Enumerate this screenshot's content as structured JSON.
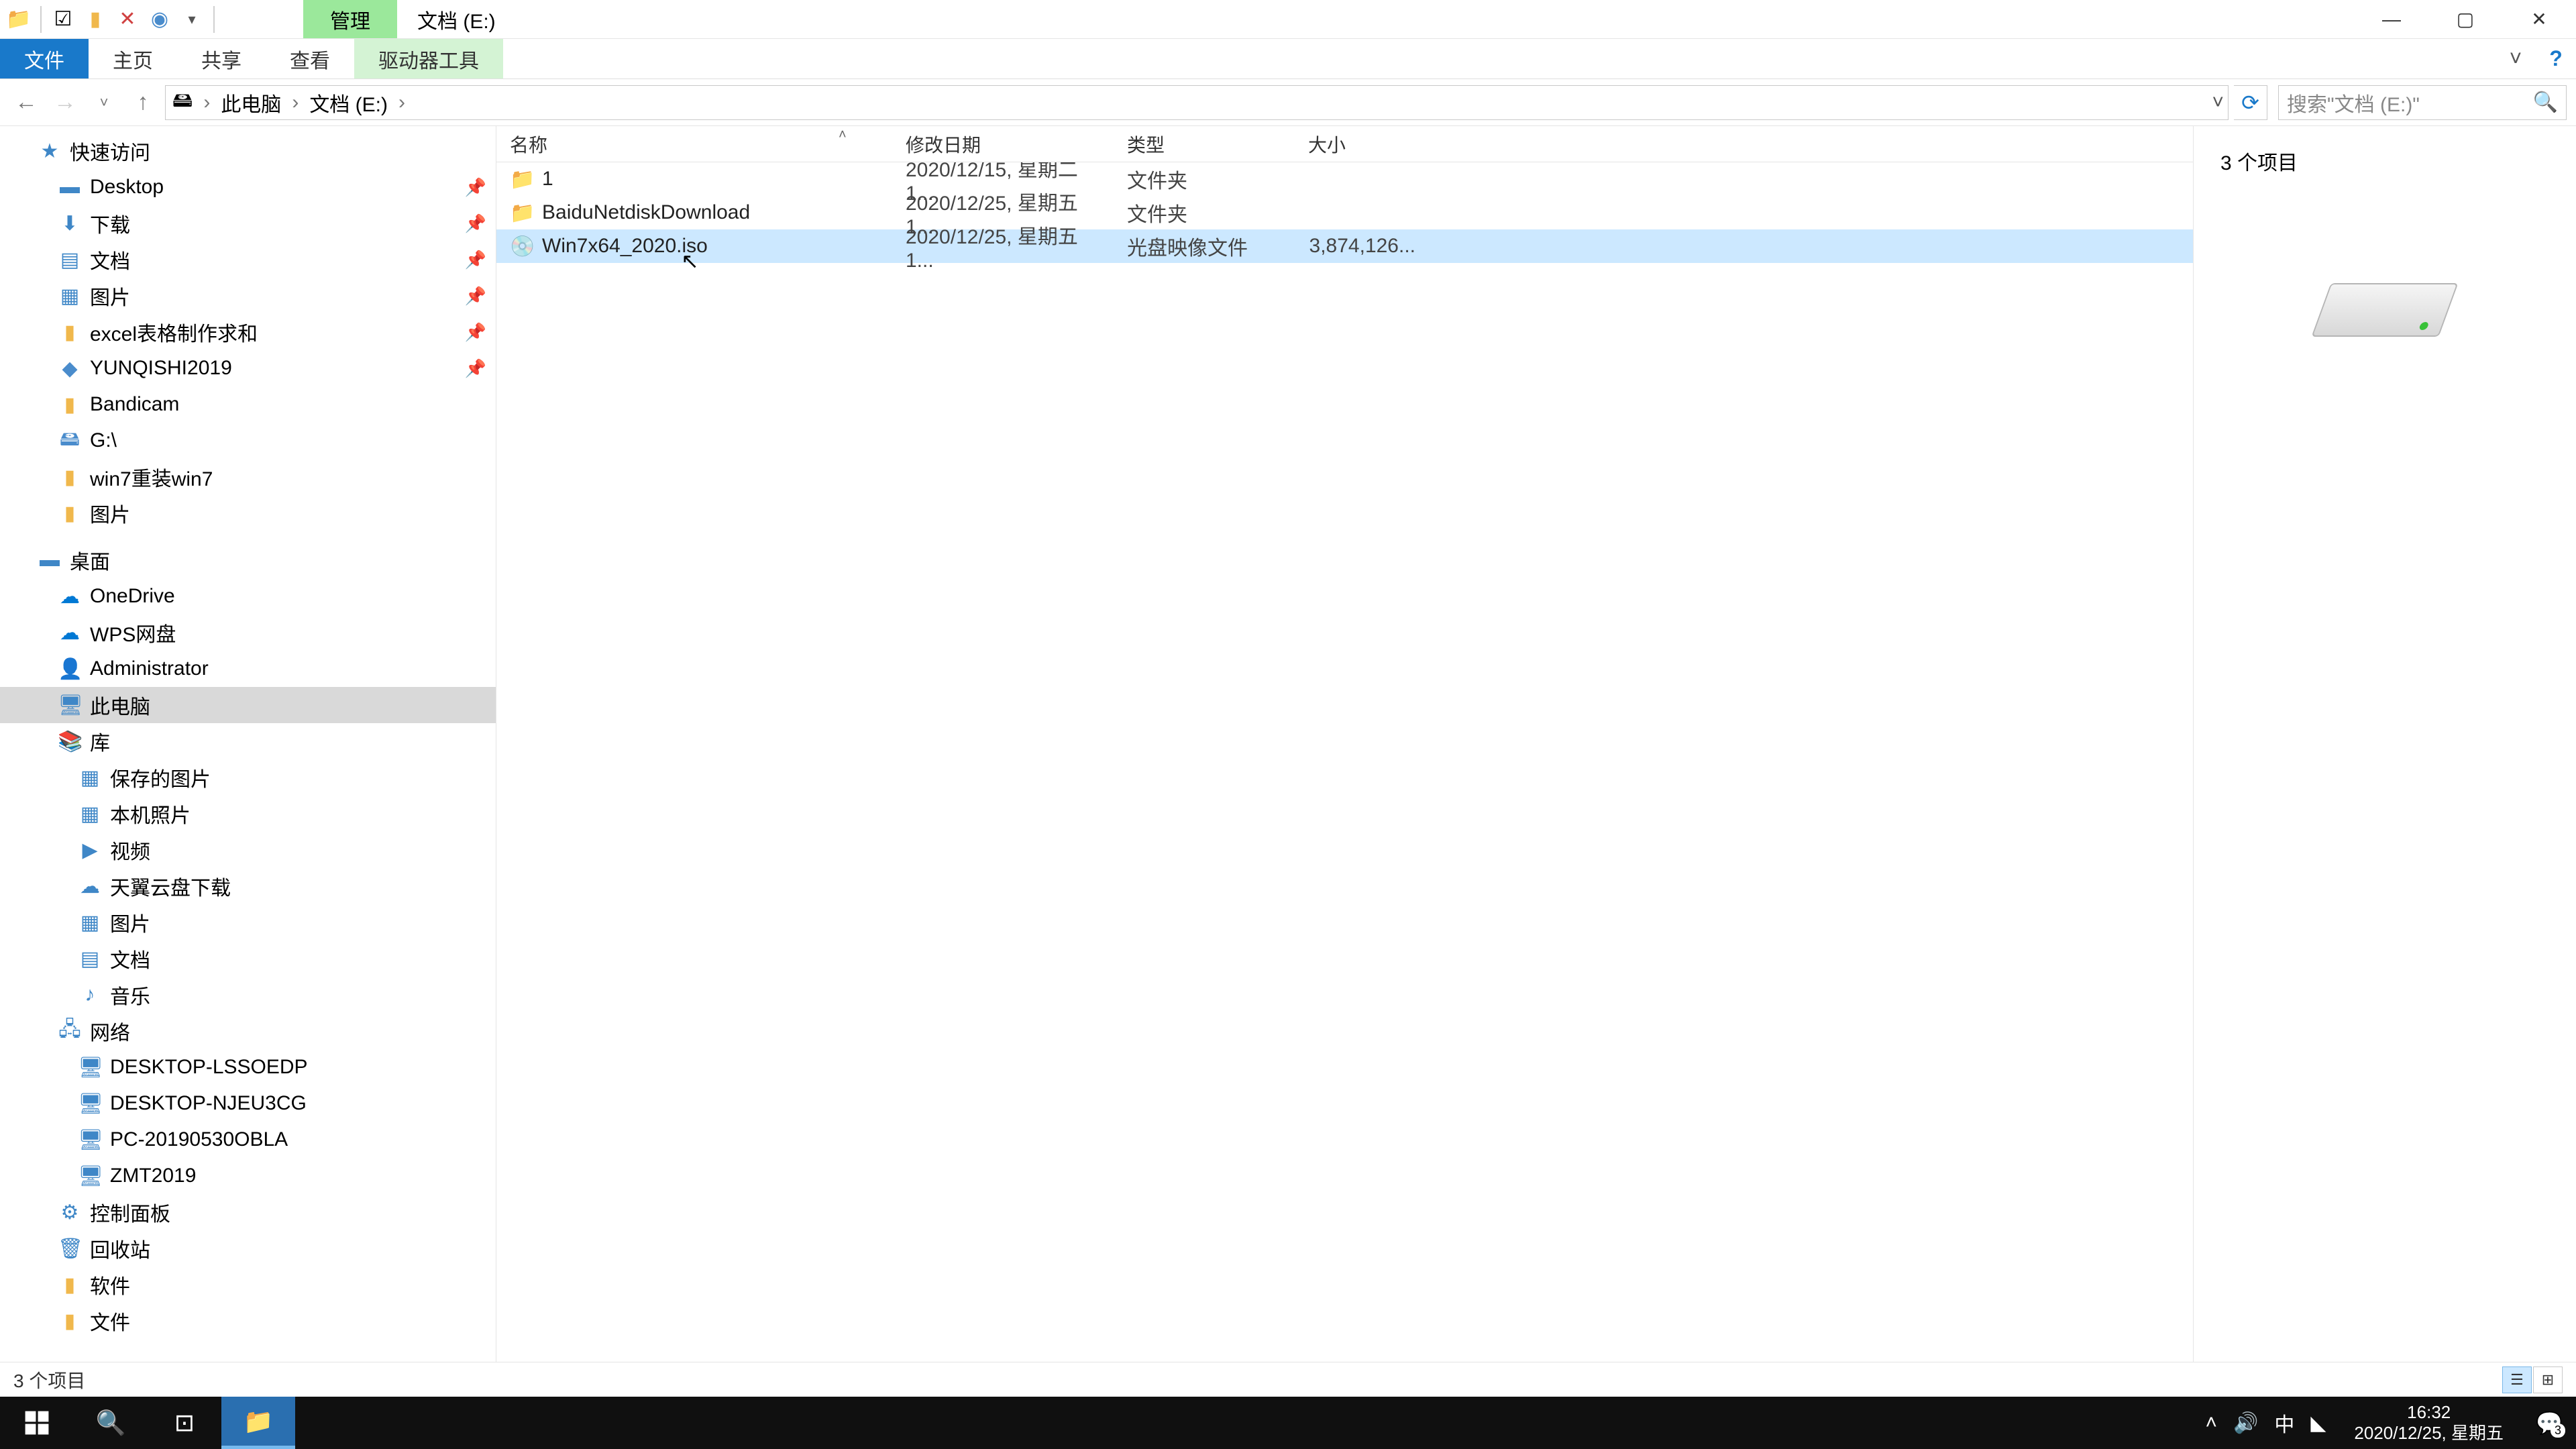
{
  "title": {
    "context_tab": "管理",
    "path_label": "文档 (E:)"
  },
  "ribbon": {
    "file": "文件",
    "home": "主页",
    "share": "共享",
    "view": "查看",
    "drive_tools": "驱动器工具"
  },
  "address": {
    "crumb1": "此电脑",
    "crumb2": "文档 (E:)"
  },
  "search": {
    "placeholder": "搜索\"文档 (E:)\""
  },
  "nav": {
    "quick_access": "快速访问",
    "desktop": "Desktop",
    "downloads": "下载",
    "documents": "文档",
    "pictures": "图片",
    "excel": "excel表格制作求和",
    "yunqi": "YUNQISHI2019",
    "bandicam": "Bandicam",
    "g_drive": "G:\\",
    "win7reinstall": "win7重装win7",
    "pictures2": "图片",
    "desktop_root": "桌面",
    "onedrive": "OneDrive",
    "wps": "WPS网盘",
    "admin": "Administrator",
    "this_pc": "此电脑",
    "libraries": "库",
    "saved_pics": "保存的图片",
    "camera_roll": "本机照片",
    "videos": "视频",
    "tianyi": "天翼云盘下载",
    "pics_lib": "图片",
    "docs_lib": "文档",
    "music_lib": "音乐",
    "network": "网络",
    "net1": "DESKTOP-LSSOEDP",
    "net2": "DESKTOP-NJEU3CG",
    "net3": "PC-20190530OBLA",
    "net4": "ZMT2019",
    "control_panel": "控制面板",
    "recycle": "回收站",
    "software": "软件",
    "files": "文件"
  },
  "columns": {
    "name": "名称",
    "date": "修改日期",
    "type": "类型",
    "size": "大小"
  },
  "files": [
    {
      "name": "1",
      "date": "2020/12/15, 星期二 1...",
      "type": "文件夹",
      "size": "",
      "icon": "folder"
    },
    {
      "name": "BaiduNetdiskDownload",
      "date": "2020/12/25, 星期五 1...",
      "type": "文件夹",
      "size": "",
      "icon": "folder"
    },
    {
      "name": "Win7x64_2020.iso",
      "date": "2020/12/25, 星期五 1...",
      "type": "光盘映像文件",
      "size": "3,874,126...",
      "icon": "iso",
      "selected": true
    }
  ],
  "preview": {
    "summary": "3 个项目"
  },
  "status": {
    "text": "3 个项目"
  },
  "taskbar": {
    "time": "16:32",
    "date": "2020/12/25, 星期五",
    "ime": "中",
    "notif_count": "3"
  }
}
